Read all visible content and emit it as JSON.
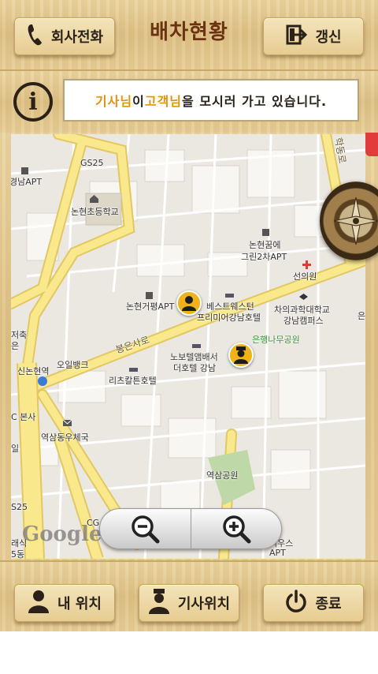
{
  "header": {
    "title": "배차현황",
    "call_label": "회사전화",
    "refresh_label": "갱신"
  },
  "info": {
    "icon": "info-icon",
    "message_parts": [
      "기사님",
      "이 ",
      "고객님",
      "을 모시러 가고 있습니다."
    ]
  },
  "map": {
    "labels": {
      "gs25_top": "GS25",
      "gyeongnam_apt": "경남APT",
      "nonhyeon_school": "논현초등학교",
      "nonhyeon_kkum": "논현꿈에",
      "green_2cha": "그린2차APT",
      "seonuiwon": "선의원",
      "nonhyeon_georyeong": "논현거평APT",
      "bestwestern_1": "베스트웨스턴",
      "bestwestern_2": "프리미어강남호텔",
      "chaui_1": "차의과학대학교",
      "chaui_2": "강남캠퍼스",
      "bongeunsa_ro": "봉은사로",
      "eunhaeng_park": "은행나무공원",
      "novotel_1": "노보텔앰배서",
      "novotel_2": "더호텔 강남",
      "riz": "리츠칼튼호텔",
      "ohil_bank": "오일뱅크",
      "sinnonhyeon_stn": "신논현역",
      "jeochuk": "저축",
      "jeochuk2": "은",
      "c_bonsa": "C 본사",
      "yeoksam_post": "역삼동우체국",
      "il": "일",
      "yeoksam_park": "역삼공원",
      "gs25_bottom": "S25",
      "cg": "CG",
      "raesik": "래식",
      "ohdong": "5동",
      "riwoos": "리우스",
      "apt_bottom": "APT",
      "hakdong_ro": "학동로",
      "eu": "은"
    },
    "google_logo": "Google",
    "zoom_out_icon": "zoom-out-icon",
    "zoom_in_icon": "zoom-in-icon"
  },
  "footer": {
    "my_location_label": "내 위치",
    "driver_location_label": "기사위치",
    "exit_label": "종료"
  },
  "colors": {
    "title": "#6b3311",
    "highlight": "#e09410",
    "road_major": "#f7e27a",
    "pin": "#f0b21a"
  }
}
